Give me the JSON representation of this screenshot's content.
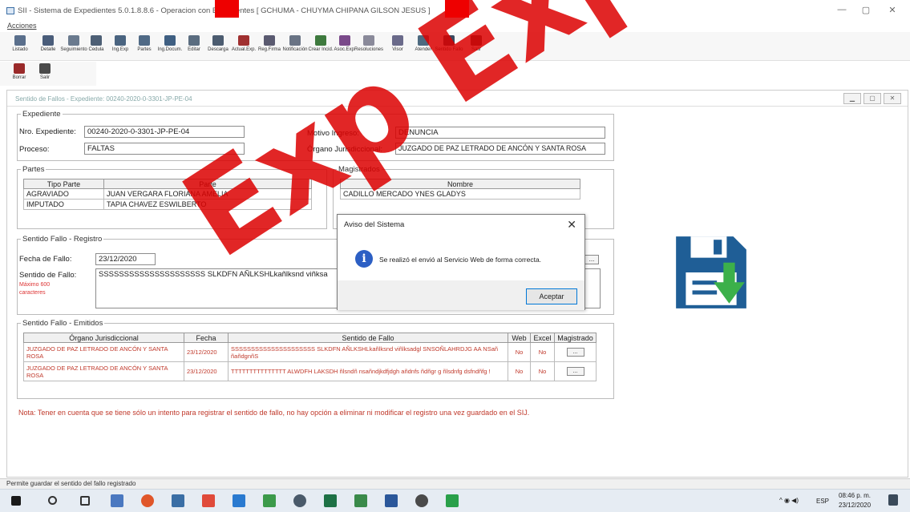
{
  "window": {
    "title": "SII - Sistema de Expedientes 5.0.1.8.8.6 - Operacion con Expedientes [ GCHUMA - CHUYMA CHIPANA GILSON JESUS ]",
    "minimize": "—",
    "restore": "▢",
    "close": "✕"
  },
  "menu": {
    "acciones": "Acciones"
  },
  "toolbar": {
    "items": [
      {
        "label": "Listado"
      },
      {
        "label": "Detalle"
      },
      {
        "label": "Seguimiento"
      },
      {
        "label": "Cedula"
      },
      {
        "label": "Ing.Exp"
      },
      {
        "label": "Partes"
      },
      {
        "label": "Ing.Docum."
      },
      {
        "label": "Editar"
      },
      {
        "label": "Descarga"
      },
      {
        "label": "Actual.Exp."
      },
      {
        "label": "Reg.Firma"
      },
      {
        "label": "Notificación"
      },
      {
        "label": "Crear Incid."
      },
      {
        "label": "Asoc.Exp."
      },
      {
        "label": "Resoluciones"
      },
      {
        "label": "Visor"
      },
      {
        "label": "Atender"
      },
      {
        "label": "Sentido Fallo"
      },
      {
        "label": "Salir"
      }
    ],
    "row2": [
      {
        "label": "Borrar"
      },
      {
        "label": "Salir"
      }
    ]
  },
  "child": {
    "title": "Sentido de Fallos - Expediente: 00240-2020-0-3301-JP-PE-04"
  },
  "expediente": {
    "legend": "Expediente",
    "nro_label": "Nro. Expediente:",
    "nro_value": "00240-2020-0-3301-JP-PE-04",
    "proceso_label": "Proceso:",
    "proceso_value": "FALTAS",
    "motivo_label": "Motivo Ingreso:",
    "motivo_value": "DENUNCIA",
    "organo_label": "Órgano Jurisdiccional:",
    "organo_value": "JUZGADO DE PAZ LETRADO DE ANCÓN Y SANTA ROSA"
  },
  "partes": {
    "legend": "Partes",
    "headers": [
      "Tipo Parte",
      "Parte"
    ],
    "rows": [
      [
        "AGRAVIADO",
        "JUAN VERGARA FLORIANA AMELIA"
      ],
      [
        "IMPUTADO",
        "TAPIA CHAVEZ ESWILBERTO"
      ]
    ]
  },
  "magistrados": {
    "legend": "Magistrados",
    "header": "Nombre",
    "rows": [
      "CADILLO MERCADO YNES GLADYS"
    ]
  },
  "registro": {
    "legend": "Sentido Fallo - Registro",
    "fecha_label": "Fecha de Fallo:",
    "fecha_value": "23/12/2020",
    "sentido_label": "Sentido de Fallo:",
    "sentido_value": "SSSSSSSSSSSSSSSSSSSSS SLKDFN AÑLKSHLkañlksnd viñksa",
    "maximo_line1": "Máximo 600",
    "maximo_line2": "caracteres",
    "dots": "..."
  },
  "emitidos": {
    "legend": "Sentido Fallo - Emitidos",
    "headers": [
      "Órgano Jurisdiccional",
      "Fecha",
      "Sentido de Fallo",
      "Web",
      "Excel",
      "Magistrado"
    ],
    "rows": [
      {
        "organo": "JUZGADO DE PAZ LETRADO DE ANCÓN Y SANTA ROSA",
        "fecha": "23/12/2020",
        "sentido": "SSSSSSSSSSSSSSSSSSSSS SLKDFN AÑLKSHLkañlksnd viñlksadgl SNSOÑLAHRDJG AA NSañ ñañdgnñS",
        "web": "No",
        "excel": "No",
        "mag": "..."
      },
      {
        "organo": "JUZGADO DE PAZ LETRADO DE ANCÓN Y SANTA ROSA",
        "fecha": "23/12/2020",
        "sentido": "TTTTTTTTTTTTTTT ALWDFH LAKSDH ñlsndñ nsañndjkdfjdgh añdnfs ñdñgr g ñlsdnfg dsfndñfg !",
        "web": "No",
        "excel": "No",
        "mag": "..."
      }
    ]
  },
  "nota": "Nota: Tener en cuenta que se tiene sólo un intento para registrar el sentido de fallo, no hay opción a eliminar ni modificar el registro una vez guardado en el SIJ.",
  "dialog": {
    "title": "Aviso del Sistema",
    "close": "✕",
    "message": "Se realizó el envió al Servicio Web de forma correcta.",
    "ok": "Aceptar"
  },
  "statusbar": {
    "text": "Permite guardar el sentido del fallo registrado"
  },
  "taskbar": {
    "lang": "ESP",
    "time": "08:46 p. m.",
    "date": "23/12/2020"
  },
  "watermark": "Exp Expedie",
  "colors": {
    "accent_red": "#c0392b",
    "dialog_info_blue": "#2c5fc4",
    "floppy_blue": "#1f5e96",
    "floppy_green": "#3cb04a"
  }
}
